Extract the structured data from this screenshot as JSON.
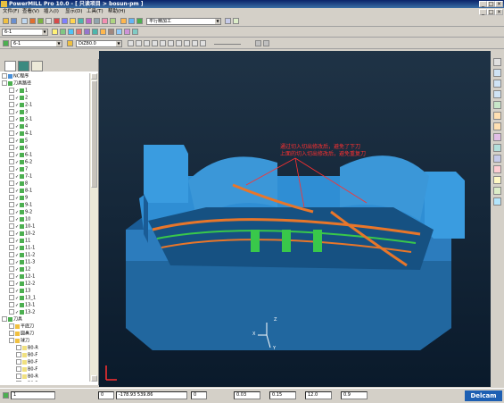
{
  "window": {
    "title": "PowerMILL Pro 10.0 - [ 只读项目 > bosun-pm ]"
  },
  "menubar": {
    "items": [
      "文件(F)",
      "查看(V)",
      "插入(I)",
      "显示(D)",
      "工具(T)",
      "帮助(H)"
    ]
  },
  "toolbar1": {
    "strategy_label": "平行精加工"
  },
  "toolbar2": {
    "toolpath_select": "6-1"
  },
  "toolbar3": {
    "tool_select": "6-1",
    "tool_name": "DiZ80.0"
  },
  "tree": {
    "root": "NC程序",
    "toolpaths_header": "刀具路径",
    "toolpaths": [
      "1",
      "2",
      "2-1",
      "3",
      "3-1",
      "4",
      "4-1",
      "5",
      "6",
      "6-1",
      "6-2",
      "7",
      "7-1",
      "8",
      "8-1",
      "9",
      "9-1",
      "9-2",
      "10",
      "10-1",
      "10-2",
      "11",
      "11-1",
      "11-2",
      "11-3",
      "12",
      "12-1",
      "12-2",
      "13",
      "13_1",
      "13-1",
      "13-2"
    ],
    "tools_header": "刀具",
    "tool_groups": [
      "平底刀",
      "圆鼻刀",
      "球刀"
    ],
    "ball_tools": [
      "B0-R",
      "B0-F",
      "B0-F",
      "B0-F",
      "B0-R",
      "B0-R",
      "B0-R"
    ]
  },
  "annotation": {
    "line1": "通过切入切出修改后，避免了下刀",
    "line2": "上面的切入切出修改后，避免重复刀"
  },
  "axes": {
    "z": "Z",
    "x": "X",
    "y": "Y"
  },
  "statusbar": {
    "selector": "1",
    "f1": "0",
    "coords": "-178.93   539.86",
    "f2": "0",
    "v1": "0.03",
    "v2": "0.15",
    "v3": "12.0",
    "v4": "0.9",
    "brand": "Delcam"
  },
  "colors": {
    "titlebar": "#0a246a",
    "viewport_bg_top": "#1f3346",
    "viewport_bg_bottom": "#0a1a2b",
    "model_top": "#2f8ed4",
    "model_side": "#1a5c96",
    "toolpath_orange": "#e8762a",
    "toolpath_green": "#39c84a",
    "annotation_red": "#ff3030"
  }
}
